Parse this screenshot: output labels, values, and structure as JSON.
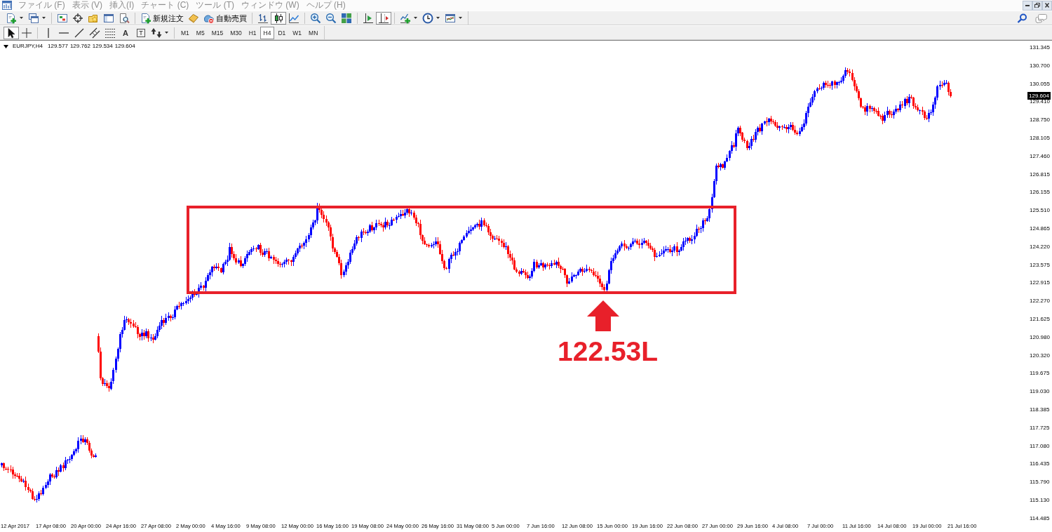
{
  "menu_bar": {
    "items": [
      "ファイル (F)",
      "表示 (V)",
      "挿入(I)",
      "チャート (C)",
      "ツール (T)",
      "ウィンドウ (W)",
      "ヘルプ (H)"
    ]
  },
  "main_toolbar": {
    "items": [
      {
        "kind": "new-chart",
        "dropdown": true
      },
      {
        "kind": "profiles",
        "dropdown": true
      },
      {
        "kind": "separator"
      },
      {
        "kind": "market-watch"
      },
      {
        "kind": "data-window"
      },
      {
        "kind": "navigator"
      },
      {
        "kind": "terminal"
      },
      {
        "kind": "tester"
      },
      {
        "kind": "separator"
      },
      {
        "kind": "new-order",
        "label": "新規注文"
      },
      {
        "kind": "editor"
      },
      {
        "kind": "auto-trading",
        "label": "自動売買"
      },
      {
        "kind": "separator"
      },
      {
        "kind": "bar-chart",
        "selected": false
      },
      {
        "kind": "candle-chart",
        "selected": true
      },
      {
        "kind": "line-chart",
        "selected": false
      },
      {
        "kind": "separator"
      },
      {
        "kind": "zoom-in"
      },
      {
        "kind": "zoom-out"
      },
      {
        "kind": "tile-windows"
      },
      {
        "kind": "separator"
      },
      {
        "kind": "auto-scroll",
        "selected": false
      },
      {
        "kind": "chart-shift",
        "selected": true
      },
      {
        "kind": "separator"
      },
      {
        "kind": "indicators",
        "dropdown": true
      },
      {
        "kind": "periods",
        "dropdown": true
      },
      {
        "kind": "templates",
        "dropdown": true
      }
    ]
  },
  "drawing_toolbar": {
    "tools": [
      {
        "kind": "cursor",
        "selected": true
      },
      {
        "kind": "crosshair",
        "selected": false
      },
      {
        "kind": "separator"
      },
      {
        "kind": "vertical-line",
        "selected": false
      },
      {
        "kind": "horizontal-line",
        "selected": false
      },
      {
        "kind": "trend-line",
        "selected": false
      },
      {
        "kind": "channel",
        "selected": false
      },
      {
        "kind": "fibonacci",
        "selected": false
      },
      {
        "kind": "text",
        "glyph": "A",
        "selected": false
      },
      {
        "kind": "label",
        "glyph": "T",
        "selected": false
      },
      {
        "kind": "arrows",
        "selected": false,
        "dropdown": true
      }
    ]
  },
  "timeframes": {
    "items": [
      {
        "label": "M1",
        "selected": false
      },
      {
        "label": "M5",
        "selected": false
      },
      {
        "label": "M15",
        "selected": false
      },
      {
        "label": "M30",
        "selected": false
      },
      {
        "label": "H1",
        "selected": false
      },
      {
        "label": "H4",
        "selected": true
      },
      {
        "label": "D1",
        "selected": false
      },
      {
        "label": "W1",
        "selected": false
      },
      {
        "label": "MN",
        "selected": false
      }
    ]
  },
  "chart": {
    "header": {
      "symbol": "EURJPY,H4",
      "ohlc": [
        "129.577",
        "129.762",
        "129.534",
        "129.604"
      ]
    },
    "price_axis": {
      "labels": [
        "131.345",
        "130.700",
        "130.055",
        "129.410",
        "128.750",
        "128.105",
        "127.460",
        "126.815",
        "126.155",
        "125.510",
        "124.865",
        "124.220",
        "123.575",
        "122.915",
        "122.270",
        "121.625",
        "120.980",
        "120.320",
        "119.675",
        "119.030",
        "118.385",
        "117.725",
        "117.080",
        "116.435",
        "115.790",
        "115.130",
        "114.485"
      ],
      "current_price": "129.604"
    },
    "time_axis": {
      "labels": [
        "12 Apr 2017",
        "17 Apr 08:00",
        "20 Apr 00:00",
        "24 Apr 16:00",
        "27 Apr 08:00",
        "2 May 00:00",
        "4 May 16:00",
        "9 May 08:00",
        "12 May 00:00",
        "16 May 16:00",
        "19 May 08:00",
        "24 May 00:00",
        "26 May 16:00",
        "31 May 08:00",
        "5 Jun 00:00",
        "7 Jun 16:00",
        "12 Jun 08:00",
        "15 Jun 00:00",
        "19 Jun 16:00",
        "22 Jun 08:00",
        "27 Jun 00:00",
        "29 Jun 16:00",
        "4 Jul 08:00",
        "7 Jul 00:00",
        "11 Jul 16:00",
        "14 Jul 08:00",
        "19 Jul 00:00",
        "21 Jul 16:00"
      ]
    },
    "annotation": {
      "label": "122.53L"
    }
  }
}
